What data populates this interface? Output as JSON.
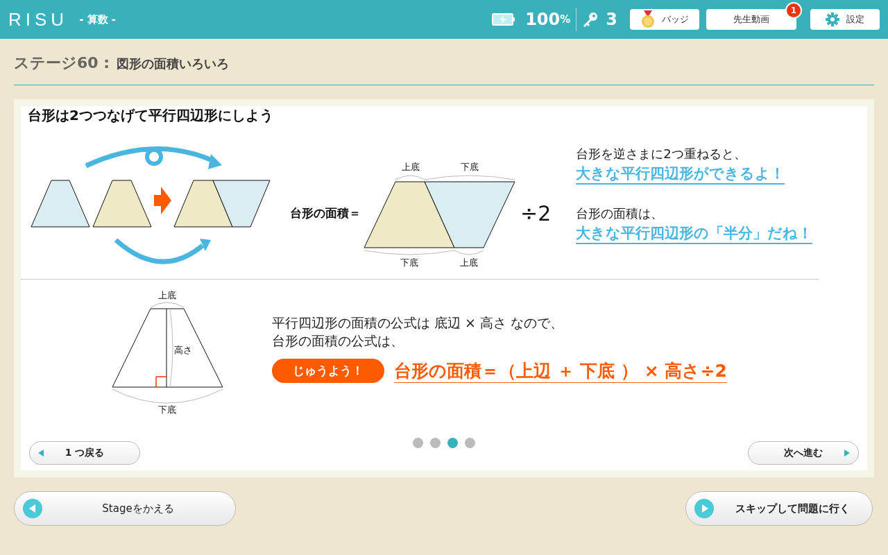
{
  "header": {
    "logo": "RISU",
    "subject": "- 算数 -",
    "battery": "100",
    "battery_unit": "%",
    "keys": "3",
    "buttons": [
      {
        "kind": "badge",
        "label": "バッジ"
      },
      {
        "kind": "video",
        "label": "先生動画",
        "notification": "1"
      },
      {
        "kind": "settings",
        "label": "設定"
      }
    ]
  },
  "stage": {
    "number": "ステージ60 :",
    "title": "図形の面積いろいろ"
  },
  "slide": {
    "heading": "台形は2つつなげて平行四辺形にしよう",
    "formula_label": "台形の面積＝",
    "top_labels": [
      "上底",
      "下底"
    ],
    "bottom_labels": [
      "下底",
      "上底"
    ],
    "divide": "÷2",
    "explanations": [
      {
        "plain": "台形を逆さまに2つ重ねると、",
        "highlight": "大きな平行四辺形ができるよ！"
      },
      {
        "plain": "台形の面積は、",
        "highlight": "大きな平行四辺形の「半分」だね！"
      }
    ],
    "trapezoid_labels": {
      "top": "上底",
      "height": "高さ",
      "bottom": "下底"
    },
    "text_lines": [
      "平行四辺形の面積の公式は 底辺 × 高さ なので、",
      "台形の面積の公式は、"
    ],
    "important": "じゅうよう！",
    "formula": "台形の面積＝（上辺 ＋ 下底 ） × 高さ÷2",
    "prev": "1 つ戻る",
    "next": "次へ進む",
    "dots": [
      {
        "selected": false
      },
      {
        "selected": false
      },
      {
        "selected": true
      },
      {
        "selected": false
      }
    ]
  },
  "footer": {
    "back": "Stageをかえる",
    "skip": "スキップして問題に行く"
  }
}
